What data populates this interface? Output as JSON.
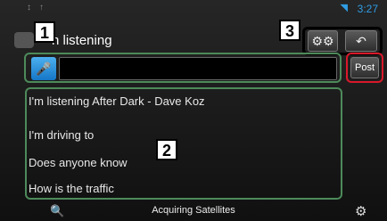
{
  "status_bar": {
    "time": "3:27",
    "icons": [
      "notification-icon",
      "signal-icon",
      "wifi-icon"
    ]
  },
  "header": {
    "title": "n listening",
    "buttons": [
      "settings-button",
      "return-button"
    ]
  },
  "callouts": {
    "one": "1",
    "two": "2",
    "three": "3"
  },
  "compose": {
    "input_value": "",
    "post_label": "Post"
  },
  "list": {
    "items": [
      "I'm listening After Dark - Dave Koz",
      "I'm driving to",
      "Does anyone know",
      "How is the traffic"
    ]
  },
  "bottom_bar": {
    "status": "Acquiring Satellites"
  },
  "colors": {
    "frame_green": "#4d8a5a",
    "frame_red": "#d8192a",
    "accent_blue": "#2f9de4"
  }
}
